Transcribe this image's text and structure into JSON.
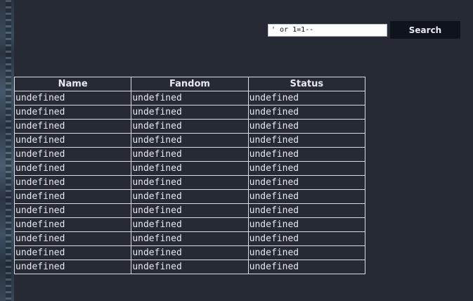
{
  "search": {
    "value": "' or 1=1--",
    "button_label": "Search"
  },
  "table": {
    "headers": [
      "Name",
      "Fandom",
      "Status"
    ],
    "rows": [
      [
        "undefined",
        "undefined",
        "undefined"
      ],
      [
        "undefined",
        "undefined",
        "undefined"
      ],
      [
        "undefined",
        "undefined",
        "undefined"
      ],
      [
        "undefined",
        "undefined",
        "undefined"
      ],
      [
        "undefined",
        "undefined",
        "undefined"
      ],
      [
        "undefined",
        "undefined",
        "undefined"
      ],
      [
        "undefined",
        "undefined",
        "undefined"
      ],
      [
        "undefined",
        "undefined",
        "undefined"
      ],
      [
        "undefined",
        "undefined",
        "undefined"
      ],
      [
        "undefined",
        "undefined",
        "undefined"
      ],
      [
        "undefined",
        "undefined",
        "undefined"
      ],
      [
        "undefined",
        "undefined",
        "undefined"
      ],
      [
        "undefined",
        "undefined",
        "undefined"
      ]
    ]
  },
  "colors": {
    "background": "#252a34",
    "button": "#0f141c",
    "text": "#e6e9ee"
  }
}
